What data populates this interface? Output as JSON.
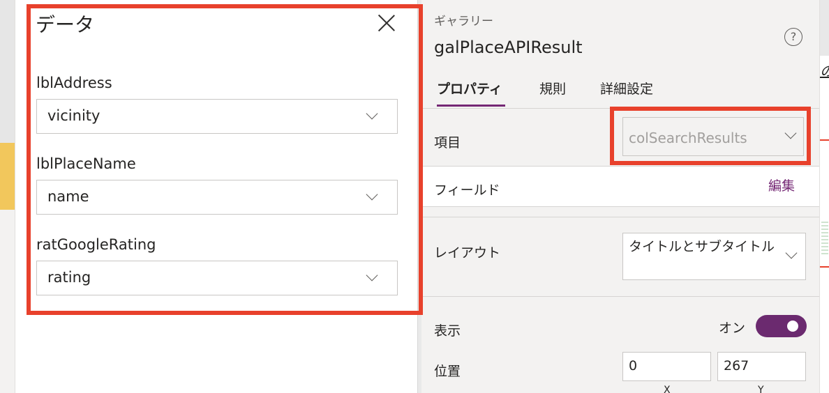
{
  "data_panel": {
    "title": "データ",
    "fields": [
      {
        "label": "lblAddress",
        "value": "vicinity"
      },
      {
        "label": "lblPlaceName",
        "value": "name"
      },
      {
        "label": "ratGoogleRating",
        "value": "rating"
      }
    ]
  },
  "properties": {
    "control_type": "ギャラリー",
    "control_name": "galPlaceAPIResult",
    "help_icon_glyph": "?",
    "tabs": [
      {
        "label": "プロパティ",
        "active": true
      },
      {
        "label": "規則",
        "active": false
      },
      {
        "label": "詳細設定",
        "active": false
      }
    ],
    "items_label": "項目",
    "items_value": "colSearchResults",
    "fields_label": "フィールド",
    "edit_label": "編集",
    "layout_label": "レイアウト",
    "layout_value": "タイトルとサブタイトル",
    "visible_label": "表示",
    "visible_state": "オン",
    "visible_on": true,
    "position_label": "位置",
    "position_x": "0",
    "position_y": "267",
    "x_label": "X",
    "y_label": "Y"
  },
  "background": {
    "right_glyph": "の"
  },
  "colors": {
    "highlight": "#e8412c",
    "accent": "#742774",
    "toggle": "#6b2a6f"
  }
}
